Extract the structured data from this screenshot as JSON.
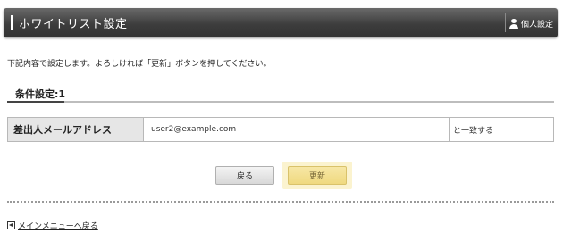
{
  "header": {
    "title": "ホワイトリスト設定",
    "settings_label": "個人設定",
    "settings_icon": "person-icon"
  },
  "instruction": "下記内容で設定します。よろしければ「更新」ボタンを押してください。",
  "section": {
    "title": "条件設定:1"
  },
  "condition": {
    "label": "差出人メールアドレス",
    "value": "user2@example.com",
    "match": "と一致する"
  },
  "buttons": {
    "back_label": "戻る",
    "update_label": "更新"
  },
  "footer": {
    "back_link_label": "メインメニューへ戻る",
    "back_link_icon": "back-arrow-icon"
  },
  "colors": {
    "header_bg": "#3d3d3d",
    "update_highlight": "#fbf3cf",
    "label_cell_bg": "#e6e6e6"
  }
}
